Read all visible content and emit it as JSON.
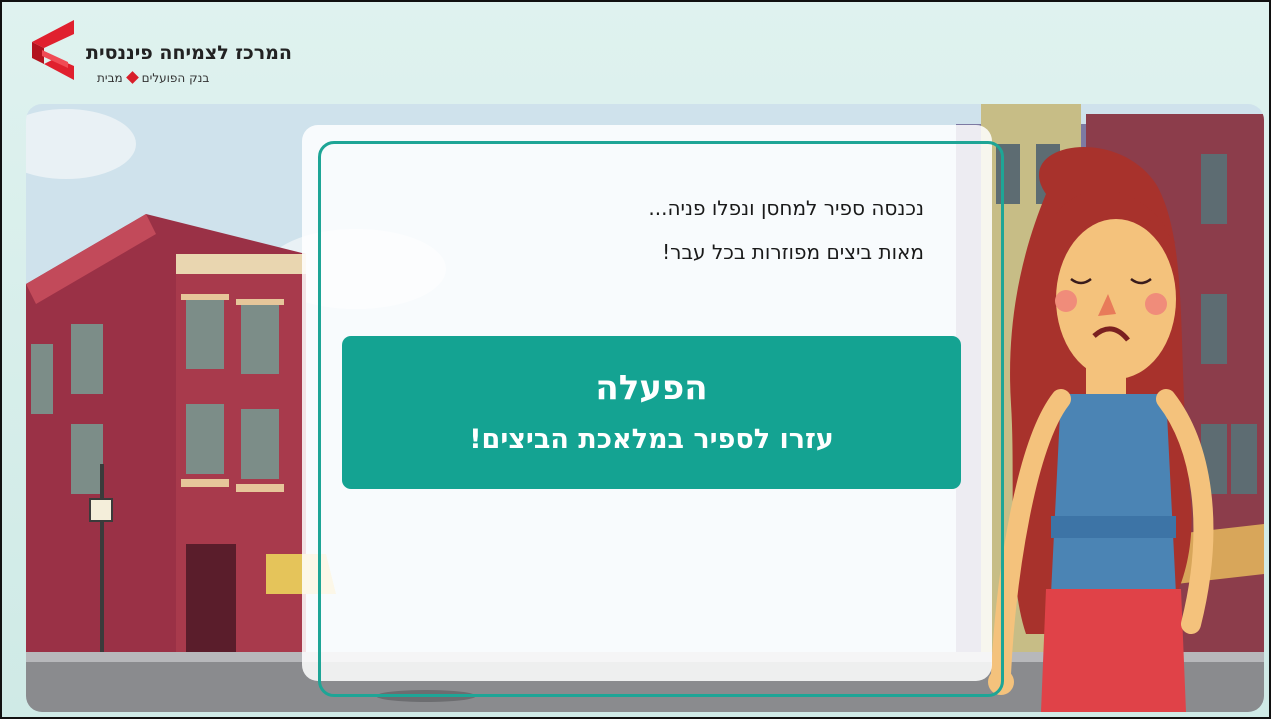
{
  "brand": {
    "title": "המרכז לצמיחה פיננסית",
    "subtitle_left": "מבית",
    "subtitle_right": "בנק הפועלים",
    "accent_color": "#d81e2a"
  },
  "panel": {
    "lines": [
      "נכנסה ספיר למחסן ונפלו פניה...",
      "מאות ביצים מפוזרות בכל עבר!"
    ]
  },
  "activity": {
    "title": "הפעלה",
    "subtitle": "עזרו לספיר במלאכת הביצים!",
    "color": "#14a392"
  }
}
